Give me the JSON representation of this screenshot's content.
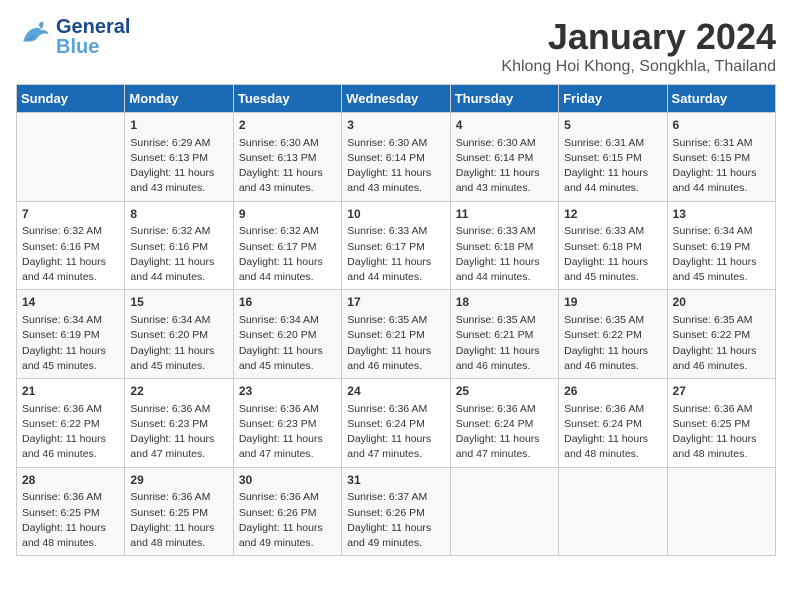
{
  "header": {
    "logo_general": "General",
    "logo_blue": "Blue",
    "month": "January 2024",
    "location": "Khlong Hoi Khong, Songkhla, Thailand"
  },
  "days_of_week": [
    "Sunday",
    "Monday",
    "Tuesday",
    "Wednesday",
    "Thursday",
    "Friday",
    "Saturday"
  ],
  "weeks": [
    [
      {
        "day": "",
        "info": ""
      },
      {
        "day": "1",
        "info": "Sunrise: 6:29 AM\nSunset: 6:13 PM\nDaylight: 11 hours\nand 43 minutes."
      },
      {
        "day": "2",
        "info": "Sunrise: 6:30 AM\nSunset: 6:13 PM\nDaylight: 11 hours\nand 43 minutes."
      },
      {
        "day": "3",
        "info": "Sunrise: 6:30 AM\nSunset: 6:14 PM\nDaylight: 11 hours\nand 43 minutes."
      },
      {
        "day": "4",
        "info": "Sunrise: 6:30 AM\nSunset: 6:14 PM\nDaylight: 11 hours\nand 43 minutes."
      },
      {
        "day": "5",
        "info": "Sunrise: 6:31 AM\nSunset: 6:15 PM\nDaylight: 11 hours\nand 44 minutes."
      },
      {
        "day": "6",
        "info": "Sunrise: 6:31 AM\nSunset: 6:15 PM\nDaylight: 11 hours\nand 44 minutes."
      }
    ],
    [
      {
        "day": "7",
        "info": "Sunrise: 6:32 AM\nSunset: 6:16 PM\nDaylight: 11 hours\nand 44 minutes."
      },
      {
        "day": "8",
        "info": "Sunrise: 6:32 AM\nSunset: 6:16 PM\nDaylight: 11 hours\nand 44 minutes."
      },
      {
        "day": "9",
        "info": "Sunrise: 6:32 AM\nSunset: 6:17 PM\nDaylight: 11 hours\nand 44 minutes."
      },
      {
        "day": "10",
        "info": "Sunrise: 6:33 AM\nSunset: 6:17 PM\nDaylight: 11 hours\nand 44 minutes."
      },
      {
        "day": "11",
        "info": "Sunrise: 6:33 AM\nSunset: 6:18 PM\nDaylight: 11 hours\nand 44 minutes."
      },
      {
        "day": "12",
        "info": "Sunrise: 6:33 AM\nSunset: 6:18 PM\nDaylight: 11 hours\nand 45 minutes."
      },
      {
        "day": "13",
        "info": "Sunrise: 6:34 AM\nSunset: 6:19 PM\nDaylight: 11 hours\nand 45 minutes."
      }
    ],
    [
      {
        "day": "14",
        "info": "Sunrise: 6:34 AM\nSunset: 6:19 PM\nDaylight: 11 hours\nand 45 minutes."
      },
      {
        "day": "15",
        "info": "Sunrise: 6:34 AM\nSunset: 6:20 PM\nDaylight: 11 hours\nand 45 minutes."
      },
      {
        "day": "16",
        "info": "Sunrise: 6:34 AM\nSunset: 6:20 PM\nDaylight: 11 hours\nand 45 minutes."
      },
      {
        "day": "17",
        "info": "Sunrise: 6:35 AM\nSunset: 6:21 PM\nDaylight: 11 hours\nand 46 minutes."
      },
      {
        "day": "18",
        "info": "Sunrise: 6:35 AM\nSunset: 6:21 PM\nDaylight: 11 hours\nand 46 minutes."
      },
      {
        "day": "19",
        "info": "Sunrise: 6:35 AM\nSunset: 6:22 PM\nDaylight: 11 hours\nand 46 minutes."
      },
      {
        "day": "20",
        "info": "Sunrise: 6:35 AM\nSunset: 6:22 PM\nDaylight: 11 hours\nand 46 minutes."
      }
    ],
    [
      {
        "day": "21",
        "info": "Sunrise: 6:36 AM\nSunset: 6:22 PM\nDaylight: 11 hours\nand 46 minutes."
      },
      {
        "day": "22",
        "info": "Sunrise: 6:36 AM\nSunset: 6:23 PM\nDaylight: 11 hours\nand 47 minutes."
      },
      {
        "day": "23",
        "info": "Sunrise: 6:36 AM\nSunset: 6:23 PM\nDaylight: 11 hours\nand 47 minutes."
      },
      {
        "day": "24",
        "info": "Sunrise: 6:36 AM\nSunset: 6:24 PM\nDaylight: 11 hours\nand 47 minutes."
      },
      {
        "day": "25",
        "info": "Sunrise: 6:36 AM\nSunset: 6:24 PM\nDaylight: 11 hours\nand 47 minutes."
      },
      {
        "day": "26",
        "info": "Sunrise: 6:36 AM\nSunset: 6:24 PM\nDaylight: 11 hours\nand 48 minutes."
      },
      {
        "day": "27",
        "info": "Sunrise: 6:36 AM\nSunset: 6:25 PM\nDaylight: 11 hours\nand 48 minutes."
      }
    ],
    [
      {
        "day": "28",
        "info": "Sunrise: 6:36 AM\nSunset: 6:25 PM\nDaylight: 11 hours\nand 48 minutes."
      },
      {
        "day": "29",
        "info": "Sunrise: 6:36 AM\nSunset: 6:25 PM\nDaylight: 11 hours\nand 48 minutes."
      },
      {
        "day": "30",
        "info": "Sunrise: 6:36 AM\nSunset: 6:26 PM\nDaylight: 11 hours\nand 49 minutes."
      },
      {
        "day": "31",
        "info": "Sunrise: 6:37 AM\nSunset: 6:26 PM\nDaylight: 11 hours\nand 49 minutes."
      },
      {
        "day": "",
        "info": ""
      },
      {
        "day": "",
        "info": ""
      },
      {
        "day": "",
        "info": ""
      }
    ]
  ]
}
